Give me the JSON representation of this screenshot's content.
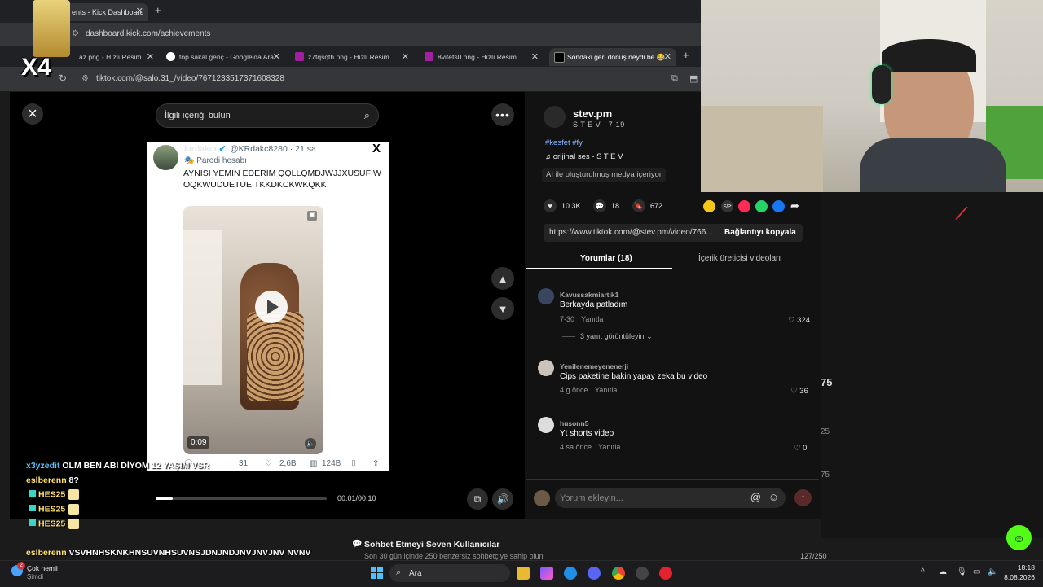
{
  "browser_top": {
    "tab_title": "ents - Kick Dashboard",
    "url": "dashboard.kick.com/achievements"
  },
  "browser_tabs": [
    {
      "title": "az.png - Hızlı Resim"
    },
    {
      "title": "top sakal genç - Google'da Ara"
    },
    {
      "title": "z7fqsqth.png - Hızlı Resim"
    },
    {
      "title": "8vitefs0.png - Hızlı Resim"
    },
    {
      "title": "Sondaki geri dönüş neydi be 😂"
    }
  ],
  "browser_second": {
    "url": "tiktok.com/@salo.31_/video/7671233517371608328"
  },
  "overlay_badge": "X4",
  "search": {
    "placeholder": "İlgili içeriği bulun"
  },
  "tweet": {
    "name": "kırdakcı",
    "handle": "@KRdakc8280 · 21 sa",
    "parody": "Parodi hesabı",
    "text": "AYNISI YEMİN EDERİM QQLLQMDJWJJXUSUFIWOQKWUDUETUEİTKKDKCKWKQKK",
    "video_time": "0:09",
    "stats": {
      "replies": "31",
      "likes": "2,6B",
      "views": "124B"
    }
  },
  "player": {
    "time": "00:01/00:10",
    "progress": 0.1
  },
  "author": {
    "name": "stev.pm",
    "meta": "S T E V · 7-19",
    "hashtags": "#kesfet #fy",
    "music": "orijinal ses - S T E V",
    "ai_label": "AI ile oluşturulmuş medya içeriyor"
  },
  "stats": {
    "likes": "10.3K",
    "comments": "18",
    "saves": "672"
  },
  "link": {
    "url": "https://www.tiktok.com/@stev.pm/video/766...",
    "copy_label": "Bağlantıyı kopyala"
  },
  "panel_tabs": {
    "comments": "Yorumlar (18)",
    "creator_videos": "İçerik üreticisi videoları"
  },
  "comments": [
    {
      "user": "Kavussakmiartık1",
      "text": "Berkayda patladım",
      "date": "7-30",
      "reply": "Yanıtla",
      "likes": "324"
    },
    {
      "user": "Yenilenemeyenenerji",
      "text": "Cips paketine bakin yapay zeka bu video",
      "date": "4 g önce",
      "reply": "Yanıtla",
      "likes": "36"
    },
    {
      "user": "husonn5",
      "text": "Yt shorts video",
      "date": "4 sa önce",
      "reply": "Yanıtla",
      "likes": "0"
    }
  ],
  "replies_label": "3 yanıt görüntüleyin",
  "comment_input": {
    "placeholder": "Yorum ekleyin..."
  },
  "chat": [
    {
      "user": "x3yzedit",
      "message": "OLM BEN ABI DİYOM 12 YAŞIM VSR"
    },
    {
      "user": "eslberenn",
      "message": "8?"
    },
    {
      "user": "HES25",
      "message": ""
    },
    {
      "user": "HES25",
      "message": ""
    },
    {
      "user": "HES25",
      "message": ""
    },
    {
      "user": "eslberenn",
      "message": "VSVHNHSKNKHNSUVNHSUVNSJDNJNDJNVJNVJNV NVNV"
    }
  ],
  "achievement": {
    "title": "Sohbet Etmeyi Seven Kullanıcılar",
    "desc": "Son 30 gün içinde 250 benzersiz sohbetçiye sahip olun",
    "progress": "127/250"
  },
  "side_numbers": [
    "75",
    "25",
    "75"
  ],
  "taskbar": {
    "search": "Ara",
    "weather": "Çok nemli",
    "weather_sub": "Şimdi",
    "time": "18:18",
    "date": "8.08.2026"
  },
  "colors": {
    "tiktok_red": "#fe2c55",
    "kick_green": "#53fc18",
    "link_blue": "#8ab4ff"
  }
}
